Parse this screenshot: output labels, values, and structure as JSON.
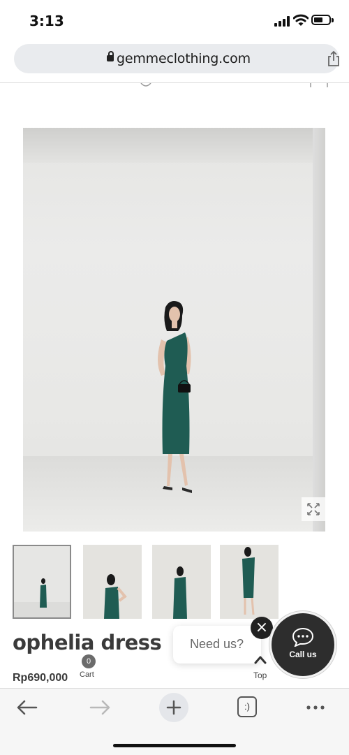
{
  "status_bar": {
    "time": "3:13"
  },
  "browser": {
    "url": "gemmeclothing.com"
  },
  "product": {
    "name": "ophelia dress",
    "price": "Rp690,000",
    "thumbnails": [
      "photo 1",
      "photo 2",
      "photo 3",
      "photo 4"
    ]
  },
  "cart": {
    "count": "0",
    "label": "Cart"
  },
  "chat": {
    "prompt": "Need us?",
    "close_symbol": "×",
    "call_label": "Call us"
  },
  "scroll_top": {
    "label": "Top"
  },
  "toolbar": {
    "tabs_label": ":)"
  },
  "colors": {
    "dress": "#1f5c53",
    "callus_bg": "#2d2d2d",
    "address_bg": "#e9ebee"
  }
}
